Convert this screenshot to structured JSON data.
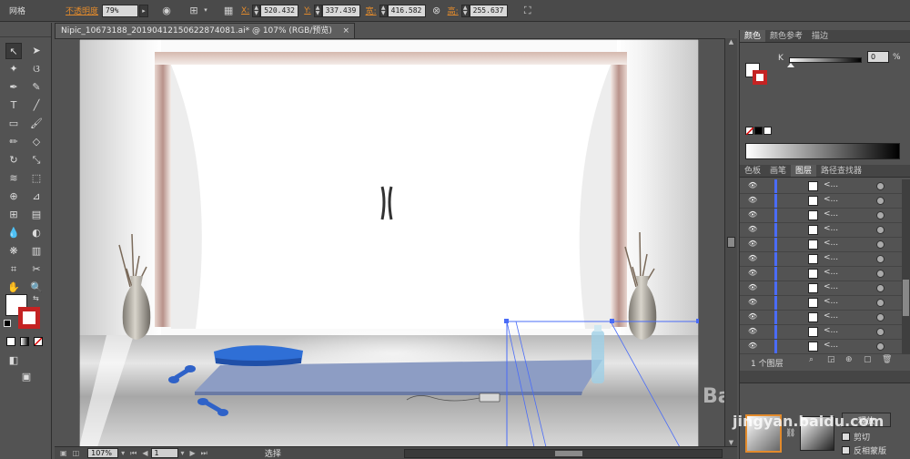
{
  "control_bar": {
    "mode_label": "网格",
    "opacity_label": "不透明度",
    "opacity_value": "79%",
    "x_label": "X:",
    "x_value": "520.432",
    "y_label": "Y:",
    "y_value": "337.439",
    "w_label": "宽:",
    "w_value": "416.582",
    "h_label": "高:",
    "h_value": "255.637"
  },
  "document": {
    "tab_title": "Nipic_10673188_20190412150622874081.ai* @ 107% (RGB/预览)",
    "close_glyph": "×"
  },
  "status_bar": {
    "zoom_value": "107%",
    "artboard_value": "1",
    "mode_text": "选择"
  },
  "color_panel": {
    "tabs": [
      "颜色",
      "颜色参考",
      "描边"
    ],
    "active_tab": 0,
    "k_label": "K",
    "k_value": "0",
    "k_unit": "%"
  },
  "layers_panel": {
    "tabs": [
      "色板",
      "画笔",
      "图层",
      "路径查找器"
    ],
    "active_tab": 2,
    "row_name": "<...",
    "row_count": 12,
    "footer_text": "1 个图层"
  },
  "transparency_panel": {
    "release_button": "释放",
    "clip_label": "剪切",
    "invert_label": "反相蒙版"
  },
  "watermark": {
    "logo_text": "Baidu",
    "site_text": "jingyan.baidu.com"
  },
  "colors": {
    "ui_bg": "#535353",
    "accent_orange": "#e38b2c",
    "selection_blue": "#4a6cf7"
  }
}
